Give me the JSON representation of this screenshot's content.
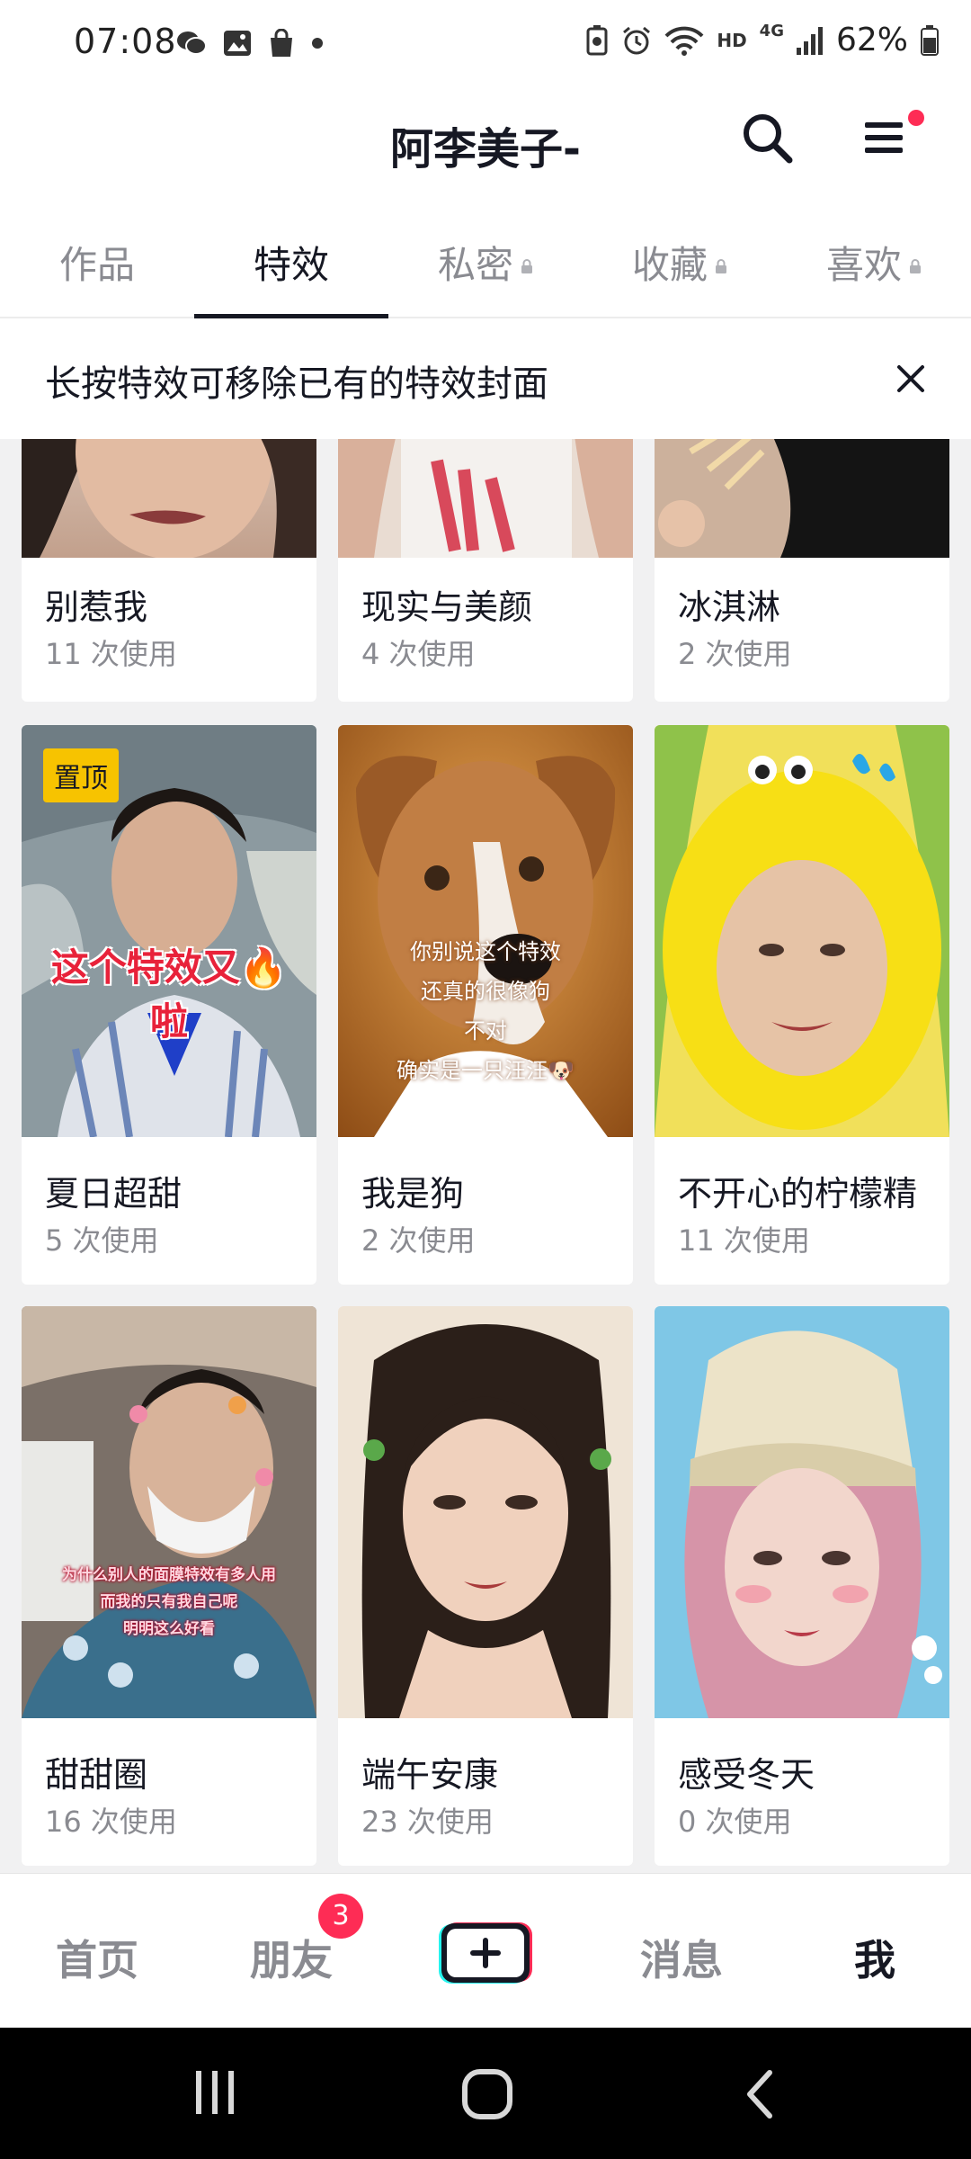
{
  "status_bar": {
    "time": "07:08",
    "battery": "62%",
    "network": "4G",
    "hd": "HD"
  },
  "header": {
    "title": "阿李美子-"
  },
  "tabs": [
    {
      "label": "作品",
      "locked": false
    },
    {
      "label": "特效",
      "locked": false,
      "active": true
    },
    {
      "label": "私密",
      "locked": true
    },
    {
      "label": "收藏",
      "locked": true
    },
    {
      "label": "喜欢",
      "locked": true
    }
  ],
  "banner": {
    "text": "长按特效可移除已有的特效封面"
  },
  "effects": [
    {
      "title": "别惹我",
      "usage": "11 次使用"
    },
    {
      "title": "现实与美颜",
      "usage": "4 次使用"
    },
    {
      "title": "冰淇淋",
      "usage": "2 次使用"
    },
    {
      "title": "夏日超甜",
      "usage": "5 次使用",
      "badge": "置顶",
      "overlay": [
        "这个特效又🔥",
        "啦"
      ]
    },
    {
      "title": "我是狗",
      "usage": "2 次使用",
      "overlay": [
        "你别说这个特效",
        "还真的很像狗",
        "不对",
        "确实是一只汪汪🐶"
      ]
    },
    {
      "title": "不开心的柠檬精",
      "usage": "11 次使用"
    },
    {
      "title": "甜甜圈",
      "usage": "16 次使用",
      "overlay": [
        "为什么别人的面膜特效有多人用",
        "而我的只有我自己呢",
        "明明这么好看"
      ]
    },
    {
      "title": "端午安康",
      "usage": "23 次使用"
    },
    {
      "title": "感受冬天",
      "usage": "0 次使用"
    }
  ],
  "bottom_nav": {
    "home": "首页",
    "friends": "朋友",
    "friends_badge": "3",
    "create": "+",
    "messages": "消息",
    "me": "我"
  },
  "colors": {
    "accent": "#fe2c55",
    "pin_badge": "#f7c300",
    "text_primary": "#161823",
    "text_secondary": "#8a8b91"
  }
}
